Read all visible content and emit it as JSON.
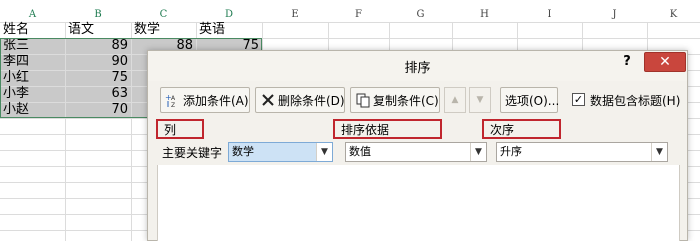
{
  "sheet": {
    "columns": [
      "A",
      "B",
      "C",
      "D",
      "E",
      "F",
      "G",
      "H",
      "I",
      "J",
      "K"
    ],
    "header_row": [
      "姓名",
      "语文",
      "数学",
      "英语"
    ],
    "rows": [
      {
        "name": "张三",
        "chinese": "89",
        "math": "88",
        "english": "75"
      },
      {
        "name": "李四",
        "chinese": "90"
      },
      {
        "name": "小红",
        "chinese": "75"
      },
      {
        "name": "小李",
        "chinese": "63"
      },
      {
        "name": "小赵",
        "chinese": "70"
      }
    ]
  },
  "dialog": {
    "title": "排序",
    "help": "?",
    "close": "✕",
    "toolbar": {
      "add_label": "添加条件(A)",
      "delete_label": "删除条件(D)",
      "copy_label": "复制条件(C)",
      "up_arrow": "▲",
      "down_arrow": "▼",
      "options_label": "选项(O)...",
      "header_checkbox_label": "数据包含标题(H)",
      "header_checkbox_checked": true
    },
    "headers": {
      "column": "列",
      "sort_on": "排序依据",
      "order": "次序"
    },
    "criteria": {
      "label": "主要关键字",
      "column_value": "数学",
      "sort_on_value": "数值",
      "order_value": "升序"
    }
  },
  "colors": {
    "selection_fill": "#c9c9c9",
    "selection_border": "#4a8a62",
    "close_button": "#c9463d",
    "highlight_box": "#c0262e",
    "focused_combo": "#cde2f5"
  }
}
